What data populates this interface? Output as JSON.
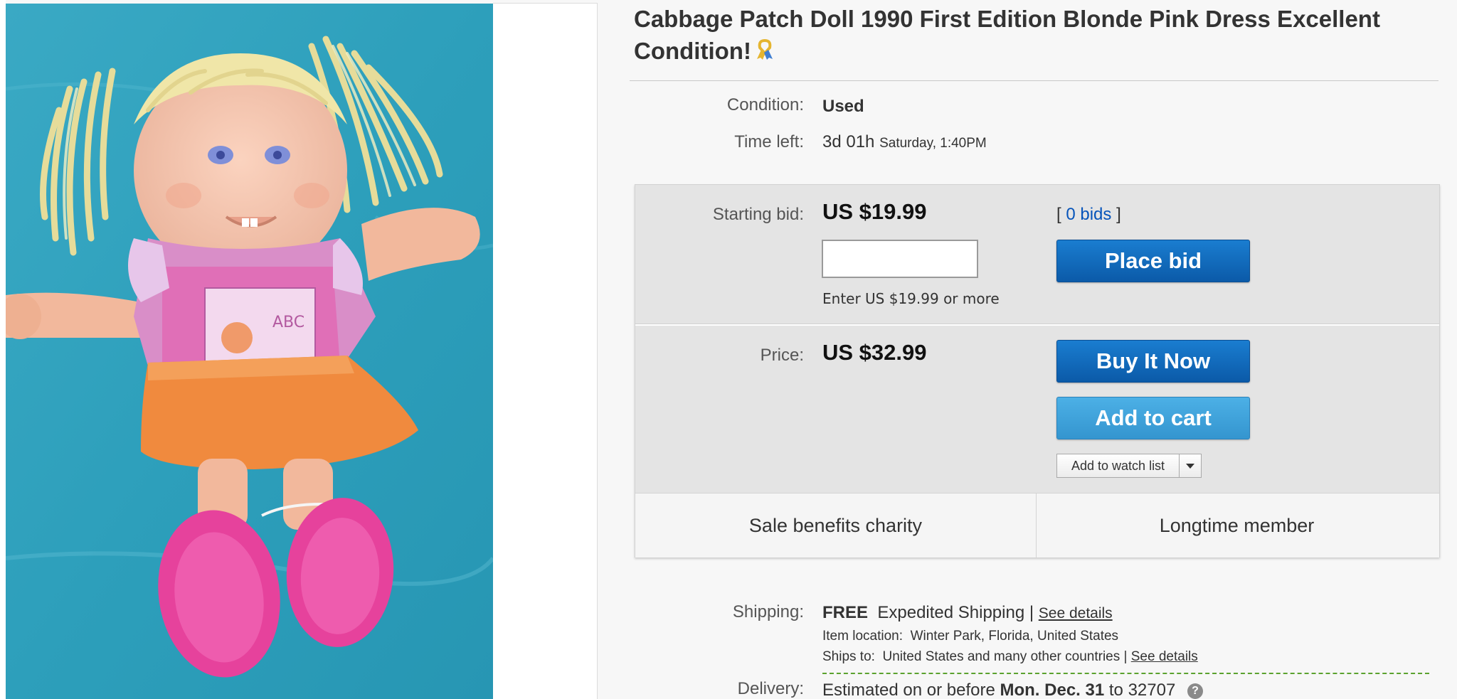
{
  "listing": {
    "title": "Cabbage Patch Doll 1990 First Edition Blonde Pink Dress Excellent Condition!",
    "ribbon_icon": "awareness-ribbon-icon",
    "condition_label": "Condition:",
    "condition_value": "Used",
    "time_left_label": "Time left:",
    "time_left_value": "3d 01h",
    "time_left_end": "Saturday, 1:40PM"
  },
  "bid": {
    "starting_label": "Starting bid:",
    "starting_price": "US $19.99",
    "bids_open": "[",
    "bids_link": "0 bids",
    "bids_close": "]",
    "input_value": "",
    "input_hint": "Enter US $19.99 or more",
    "place_bid_label": "Place bid",
    "price_label": "Price:",
    "price_value": "US $32.99",
    "buy_now_label": "Buy It Now",
    "add_cart_label": "Add to cart",
    "watch_label": "Add to watch list",
    "charity_label": "Sale benefits charity",
    "member_label": "Longtime member"
  },
  "shipping": {
    "label": "Shipping:",
    "free": "FREE",
    "method": "Expedited Shipping",
    "separator": "|",
    "details_link": "See details",
    "location_label": "Item location:",
    "location_value": "Winter Park, Florida, United States",
    "ships_to_label": "Ships to:",
    "ships_to_value": "United States and many other countries",
    "ships_to_separator": "|",
    "ships_to_link": "See details"
  },
  "delivery": {
    "label": "Delivery:",
    "prefix": "Estimated on or before",
    "date": "Mon. Dec. 31",
    "to_word": "to",
    "zip": "32707",
    "help_icon": "?"
  },
  "colors": {
    "primary_button": "#0b5aa8",
    "secondary_button": "#3495cf",
    "link": "#0654ba",
    "bid_panel": "#e4e4e4"
  }
}
